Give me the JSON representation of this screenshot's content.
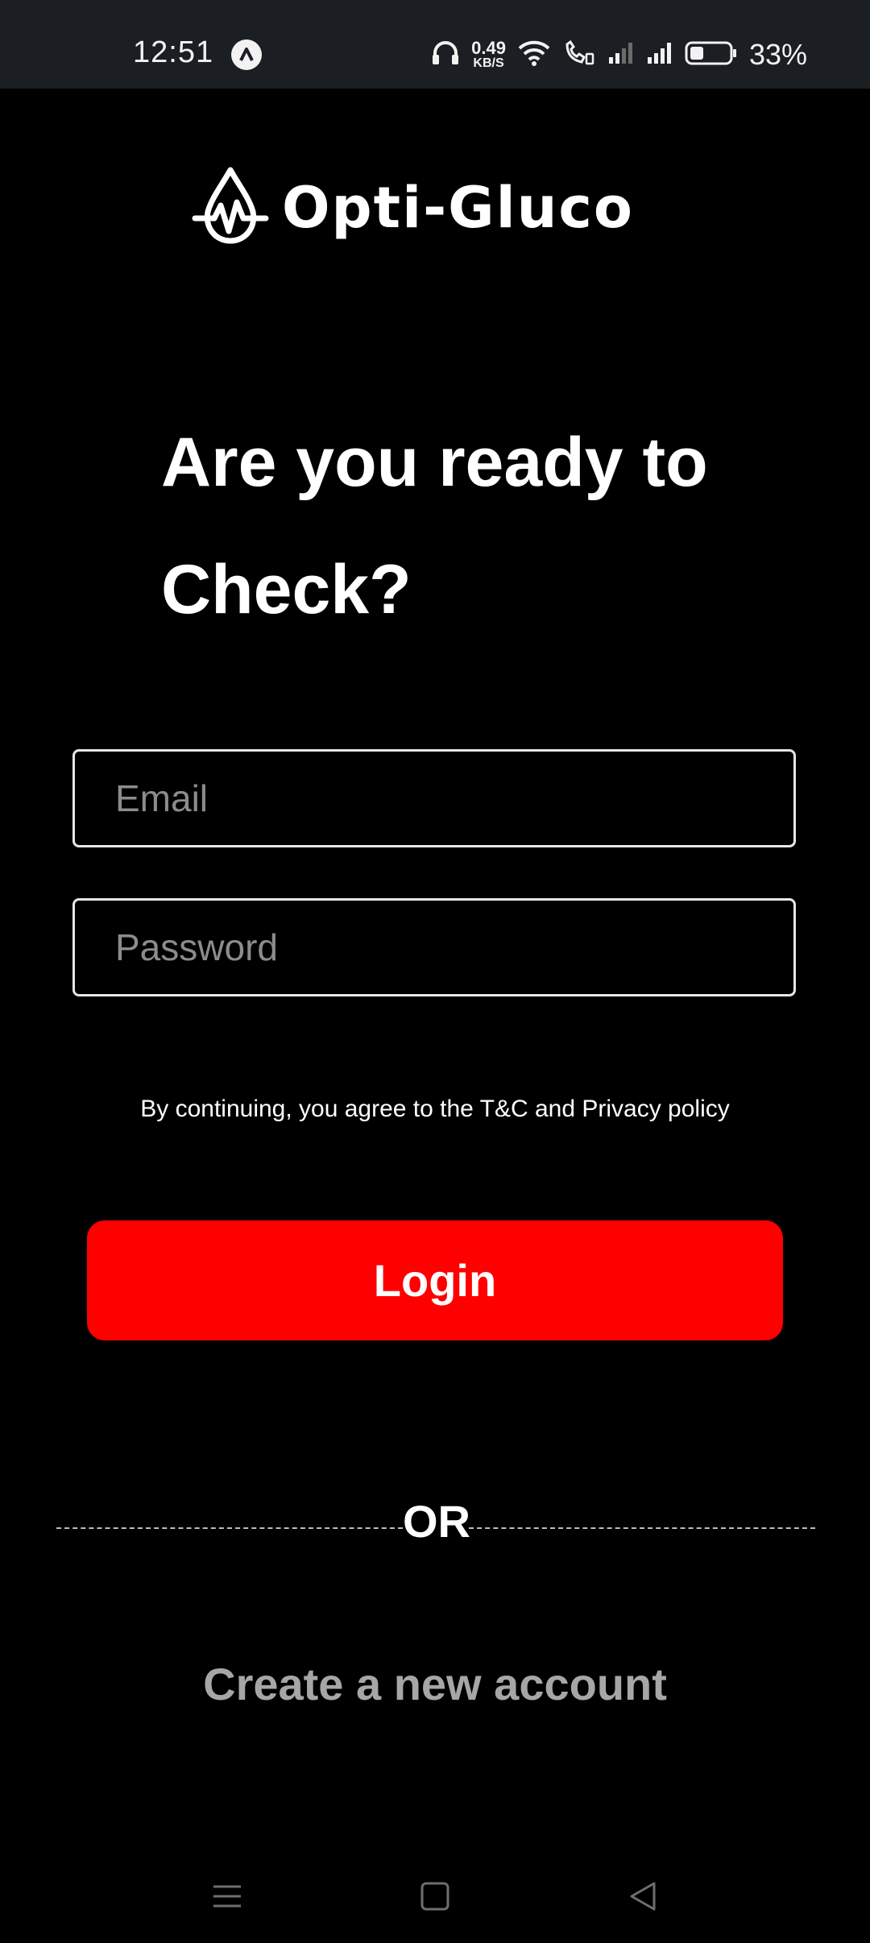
{
  "status_bar": {
    "time": "12:51",
    "net_speed_value": "0.49",
    "net_speed_unit": "KB/S",
    "battery_percent": "33%",
    "icons": [
      "app-notification-icon",
      "headphones-icon",
      "wifi-icon",
      "wifi-calling-icon",
      "signal-icon-sim1",
      "signal-icon-sim2",
      "battery-icon"
    ]
  },
  "logo": {
    "text": "Opti-Gluco",
    "icon": "drop-pulse-icon"
  },
  "headline": {
    "line1": "Are you ready to",
    "line2": "Check?"
  },
  "form": {
    "email_placeholder": "Email",
    "email_value": "",
    "password_placeholder": "Password",
    "password_value": ""
  },
  "terms_text": "By continuing, you agree to the T&C and Privacy policy",
  "login_label": "Login",
  "divider_label": "OR",
  "create_account_label": "Create a new account",
  "nav_bar": {
    "icons": [
      "menu-icon",
      "home-icon",
      "back-icon"
    ]
  },
  "colors": {
    "background": "#000000",
    "primary_button": "#ff0000",
    "status_bar": "#1b1e22",
    "secondary_text": "#a6a6a6",
    "placeholder": "#8c8c8c"
  }
}
